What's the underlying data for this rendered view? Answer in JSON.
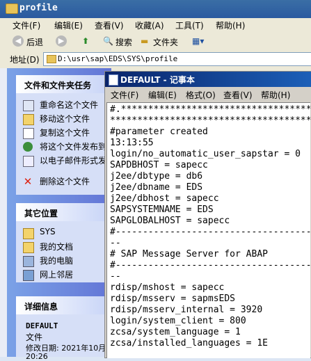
{
  "explorer": {
    "title": "profile",
    "menu": [
      "文件(F)",
      "编辑(E)",
      "查看(V)",
      "收藏(A)",
      "工具(T)",
      "帮助(H)"
    ],
    "toolbar": {
      "back": "后退",
      "search": "搜索",
      "folders": "文件夹"
    },
    "address_label": "地址(D)",
    "address_value": "D:\\usr\\sap\\EDS\\SYS\\profile"
  },
  "taskpane": {
    "file_tasks": {
      "title": "文件和文件夹任务",
      "items": [
        "重命名这个文件",
        "移动这个文件",
        "复制这个文件",
        "将这个文件发布到",
        "以电子邮件形式发",
        "删除这个文件"
      ]
    },
    "other_places": {
      "title": "其它位置",
      "items": [
        "SYS",
        "我的文档",
        "我的电脑",
        "网上邻居"
      ]
    },
    "details": {
      "title": "详细信息",
      "name": "DEFAULT",
      "type": "文件",
      "modified": "修改日期: 2021年10月",
      "time": "20:26"
    }
  },
  "notepad": {
    "title": "DEFAULT - 记事本",
    "menu": [
      "文件(F)",
      "编辑(E)",
      "格式(O)",
      "查看(V)",
      "帮助(H)"
    ],
    "lines": [
      "#.************************************",
      "**************************************",
      "#parameter created",
      "13:13:55",
      "login/no_automatic_user_sapstar = 0",
      "SAPDBHOST = sapecc",
      "j2ee/dbtype = db6",
      "j2ee/dbname = EDS",
      "j2ee/dbhost = sapecc",
      "SAPSYSTEMNAME = EDS",
      "SAPGLOBALHOST = sapecc",
      "#-------------------------------------",
      "--",
      "# SAP Message Server for ABAP",
      "#-------------------------------------",
      "--",
      "rdisp/mshost = sapecc",
      "rdisp/msserv = sapmsEDS",
      "rdisp/msserv_internal = 3920",
      "login/system_client = 800",
      "zcsa/system_language = 1",
      "zcsa/installed_languages = 1E"
    ]
  },
  "colors": {
    "xp_title": "#2b5aa0",
    "notepad_title": "#0a246a",
    "taskpane": "#6375d6"
  }
}
